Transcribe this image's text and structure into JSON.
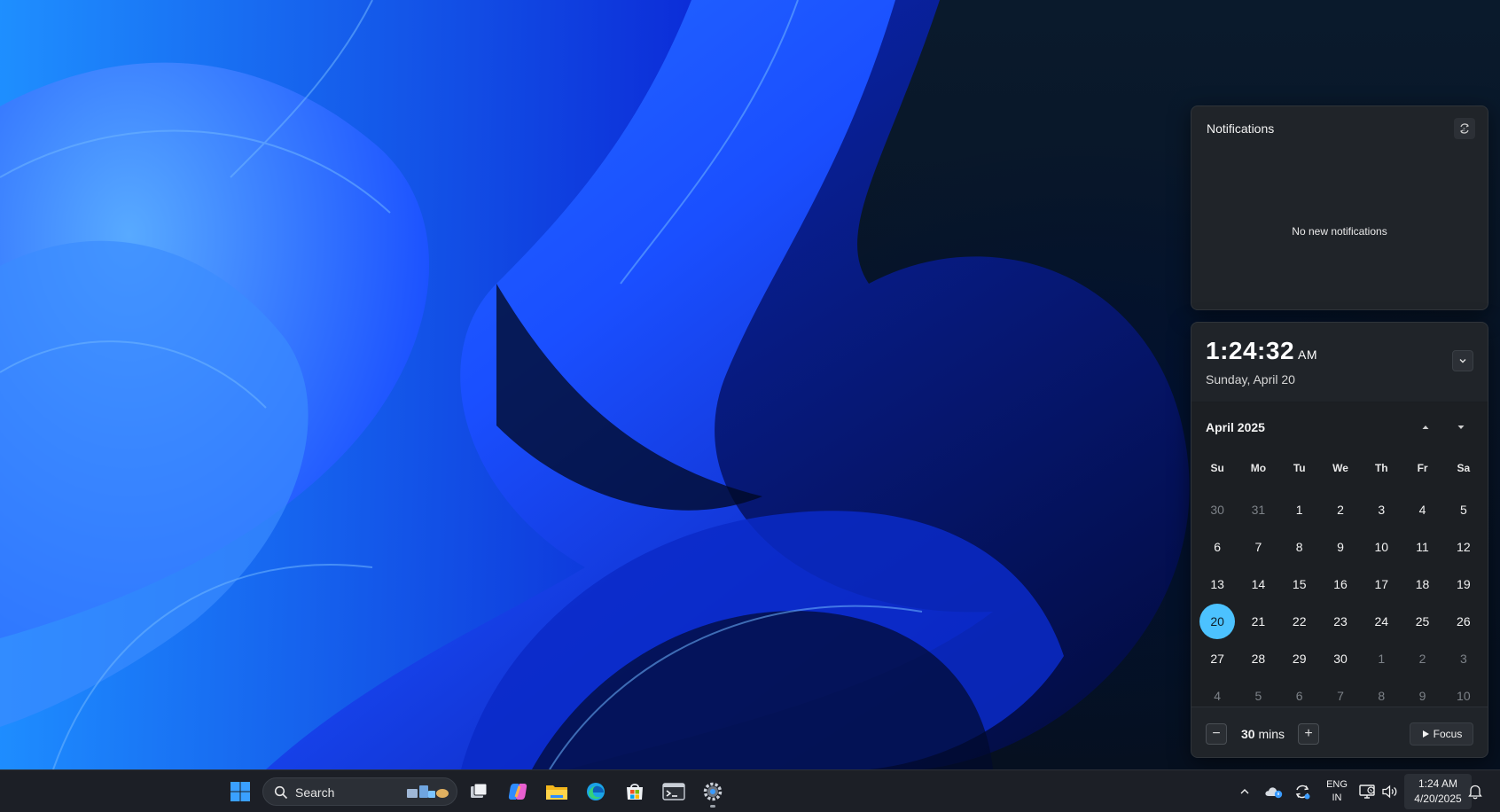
{
  "notifications": {
    "title": "Notifications",
    "empty_message": "No new notifications",
    "settings_icon": "notification-settings-icon"
  },
  "clock": {
    "time": "1:24:32",
    "ampm": "AM",
    "date": "Sunday, April 20"
  },
  "calendar": {
    "month": "April 2025",
    "weekdays": [
      "Su",
      "Mo",
      "Tu",
      "We",
      "Th",
      "Fr",
      "Sa"
    ],
    "days": [
      {
        "d": "30",
        "m": true
      },
      {
        "d": "31",
        "m": true
      },
      {
        "d": "1"
      },
      {
        "d": "2"
      },
      {
        "d": "3"
      },
      {
        "d": "4"
      },
      {
        "d": "5"
      },
      {
        "d": "6"
      },
      {
        "d": "7"
      },
      {
        "d": "8"
      },
      {
        "d": "9"
      },
      {
        "d": "10"
      },
      {
        "d": "11"
      },
      {
        "d": "12"
      },
      {
        "d": "13"
      },
      {
        "d": "14"
      },
      {
        "d": "15"
      },
      {
        "d": "16"
      },
      {
        "d": "17"
      },
      {
        "d": "18"
      },
      {
        "d": "19"
      },
      {
        "d": "20",
        "today": true
      },
      {
        "d": "21"
      },
      {
        "d": "22"
      },
      {
        "d": "23"
      },
      {
        "d": "24"
      },
      {
        "d": "25"
      },
      {
        "d": "26"
      },
      {
        "d": "27"
      },
      {
        "d": "28"
      },
      {
        "d": "29"
      },
      {
        "d": "30"
      },
      {
        "d": "1",
        "m": true
      },
      {
        "d": "2",
        "m": true
      },
      {
        "d": "3",
        "m": true
      },
      {
        "d": "4",
        "m": true
      },
      {
        "d": "5",
        "m": true
      },
      {
        "d": "6",
        "m": true
      },
      {
        "d": "7",
        "m": true
      },
      {
        "d": "8",
        "m": true
      },
      {
        "d": "9",
        "m": true
      },
      {
        "d": "10",
        "m": true
      }
    ],
    "accent": "#4cc2ff"
  },
  "focus": {
    "minus": "−",
    "value": "30",
    "unit": "mins",
    "plus": "+",
    "button_label": "Focus"
  },
  "taskbar": {
    "search_label": "Search",
    "apps": [
      "start-icon",
      "task-view-icon",
      "copilot-icon",
      "file-explorer-icon",
      "edge-icon",
      "store-icon",
      "terminal-icon",
      "settings-icon"
    ],
    "tray": {
      "lang_top": "ENG",
      "lang_bottom": "IN",
      "time": "1:24 AM",
      "date": "4/20/2025"
    }
  }
}
